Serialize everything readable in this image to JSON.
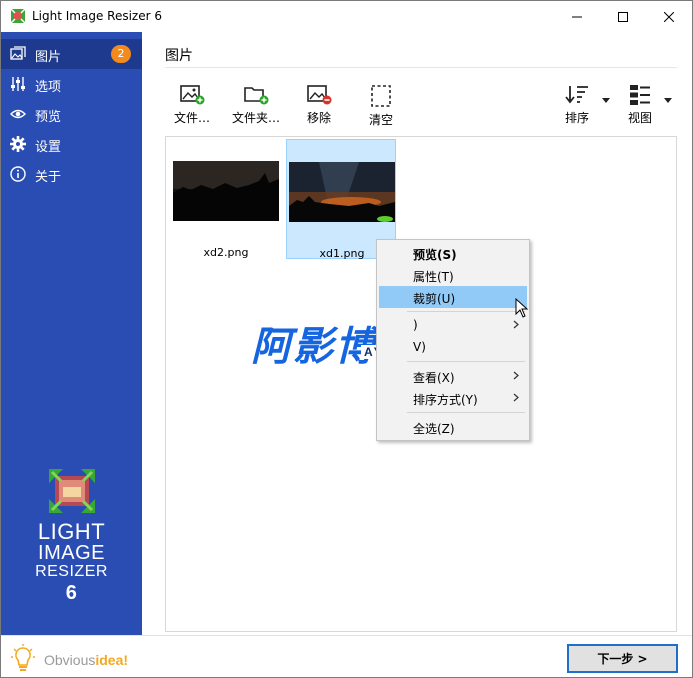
{
  "window": {
    "title": "Light Image Resizer 6",
    "controls": {
      "minimize": "minimize-icon",
      "maximize": "maximize-icon",
      "close": "close-icon"
    }
  },
  "sidebar": {
    "background": "#2a4db3",
    "items": [
      {
        "label": "图片",
        "icon": "images-icon",
        "badge": "2",
        "active": true
      },
      {
        "label": "选项",
        "icon": "sliders-icon"
      },
      {
        "label": "预览",
        "icon": "eye-icon"
      },
      {
        "label": "设置",
        "icon": "gear-icon"
      },
      {
        "label": "关于",
        "icon": "info-icon"
      }
    ],
    "logo": {
      "line1": "LIGHT",
      "line2": "IMAGE",
      "line3": "RESIZER",
      "line4": "6"
    },
    "brand": {
      "prefix": "Obvious",
      "accent": "idea!"
    }
  },
  "main": {
    "section_title": "图片",
    "toolbar": {
      "add_files": "文件…",
      "add_folder": "文件夹…",
      "remove": "移除",
      "clear": "清空",
      "sort": "排序",
      "view": "视图"
    },
    "files": [
      {
        "name": "xd2.png",
        "selected": false
      },
      {
        "name": "xd1.png",
        "selected": true
      }
    ],
    "next_button": "下一步 >"
  },
  "context_menu": {
    "items": [
      {
        "label": "预览(S)",
        "bold": true
      },
      {
        "label": "属性(T)"
      },
      {
        "label": "裁剪(U)",
        "highlighted": true
      },
      {
        "label": ")",
        "has_submenu": true
      },
      {
        "label": "V)"
      },
      {
        "label": "查看(X)",
        "has_submenu": true
      },
      {
        "label": "排序方式(Y)",
        "has_submenu": true
      },
      {
        "label": "全选(Z)"
      }
    ]
  },
  "watermark": {
    "cn": "阿影博客",
    "en": "AYBK.CN"
  },
  "colors": {
    "accent": "#1f6fc8",
    "badge": "#f28a1e",
    "selection": "#cce8ff",
    "menu_highlight": "#91c9f7"
  }
}
